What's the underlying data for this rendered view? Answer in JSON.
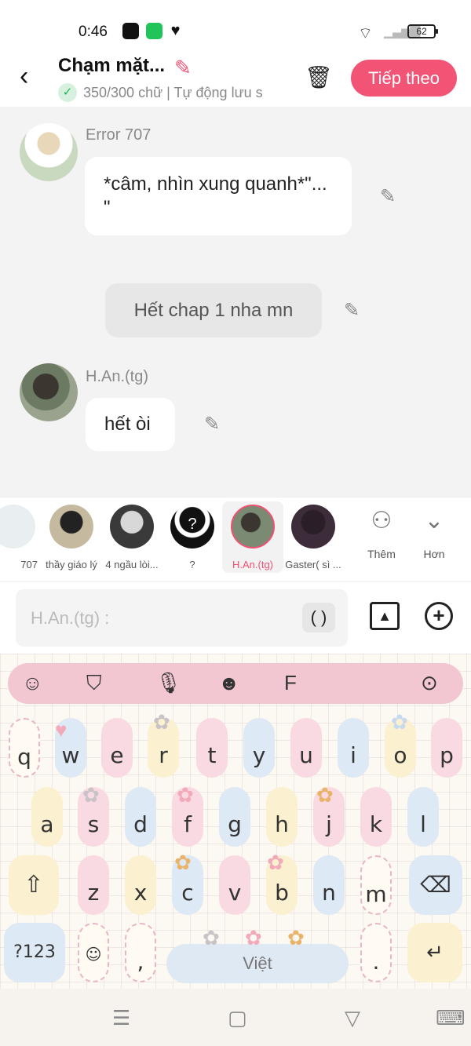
{
  "status": {
    "time": "0:46",
    "battery": "62"
  },
  "header": {
    "title": "Chạm mặt...",
    "subtitle": "350/300 chữ | Tự động lưu s",
    "next_label": "Tiếp theo"
  },
  "chat": {
    "msg1": {
      "name": "Error 707",
      "text": "*câm, nhìn xung quanh*\"... \""
    },
    "narration": "Hết chap 1 nha mn",
    "msg2": {
      "name": "H.An.(tg)",
      "text": "hết òi"
    }
  },
  "characters": [
    {
      "label": "707"
    },
    {
      "label": "thầy giáo lý"
    },
    {
      "label": "4 ngầu lòi..."
    },
    {
      "label": "?"
    },
    {
      "label": "H.An.(tg)"
    },
    {
      "label": "Gaster( sì ..."
    }
  ],
  "strip_buttons": {
    "add_label": "Thêm",
    "more_label": "Hơn"
  },
  "input": {
    "placeholder": "H.An.(tg) :",
    "paren_label": "( )"
  },
  "keyboard": {
    "row1": [
      "q",
      "w",
      "e",
      "r",
      "t",
      "y",
      "u",
      "i",
      "o",
      "p"
    ],
    "row2": [
      "a",
      "s",
      "d",
      "f",
      "g",
      "h",
      "j",
      "k",
      "l"
    ],
    "row3": [
      "z",
      "x",
      "c",
      "v",
      "b",
      "n",
      "m"
    ],
    "numbers_label": "?123",
    "comma": ",",
    "space_label": "Việt",
    "period": "."
  },
  "colors": {
    "accent": "#f25476",
    "keyboard_toolbar": "#f3c7d2"
  }
}
